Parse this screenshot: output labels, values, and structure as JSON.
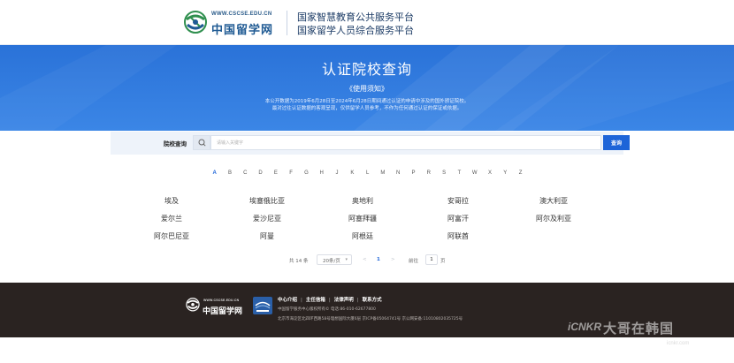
{
  "header": {
    "logo_domain": "WWW.CSCSE.EDU.CN",
    "logo_name": "中国留学网",
    "platform_line1": "国家智慧教育公共服务平台",
    "platform_line2": "国家留学人员综合服务平台"
  },
  "hero": {
    "title": "认证院校查询",
    "notice_link": "《使用须知》",
    "desc_line1": "本公开数据为2019年6月28日至2024年6月28日期间通过认证的申请中涉及的国外颁证院校。",
    "desc_line2": "最对过往认证数据的客观呈现，仅供留学人员参考，不作为任何通过认证的保证或依据。"
  },
  "search": {
    "label": "院校查询",
    "placeholder": "请输入关键字",
    "button_label": "查询"
  },
  "alphabet": {
    "letters": [
      "A",
      "B",
      "C",
      "D",
      "E",
      "F",
      "G",
      "H",
      "J",
      "K",
      "L",
      "M",
      "N",
      "P",
      "R",
      "S",
      "T",
      "W",
      "X",
      "Y",
      "Z"
    ],
    "active": "A"
  },
  "countries": [
    "埃及",
    "埃塞俄比亚",
    "奥地利",
    "安哥拉",
    "澳大利亚",
    "爱尔兰",
    "爱沙尼亚",
    "阿塞拜疆",
    "阿富汗",
    "阿尔及利亚",
    "阿尔巴尼亚",
    "阿曼",
    "阿根廷",
    "阿联酋"
  ],
  "pagination": {
    "total": "共 14 条",
    "page_size": "20条/页",
    "prev": "<",
    "current": "1",
    "next": ">",
    "goto_prefix": "前往",
    "goto_value": "1",
    "goto_suffix": "页"
  },
  "footer": {
    "logo_domain": "WWW.CSCSE.EDU.CN",
    "logo_name": "中国留学网",
    "links": [
      "中心介绍",
      "主任信箱",
      "法律声明",
      "联系方式"
    ],
    "line1": "中国留学服务中心版权所有©   电话:86-010-62677800",
    "line2": "北京市海淀区北四环西路58号理想国际大厦6层   京ICP备05064741号   京公网安备:11010802035725号"
  },
  "watermark": {
    "en": "iCNKR",
    "cn": "大哥在韩国",
    "url": "icnkr.com"
  },
  "colors": {
    "accent": "#1d64d8",
    "hero": "#2a72d8",
    "footer": "#2a2321"
  }
}
